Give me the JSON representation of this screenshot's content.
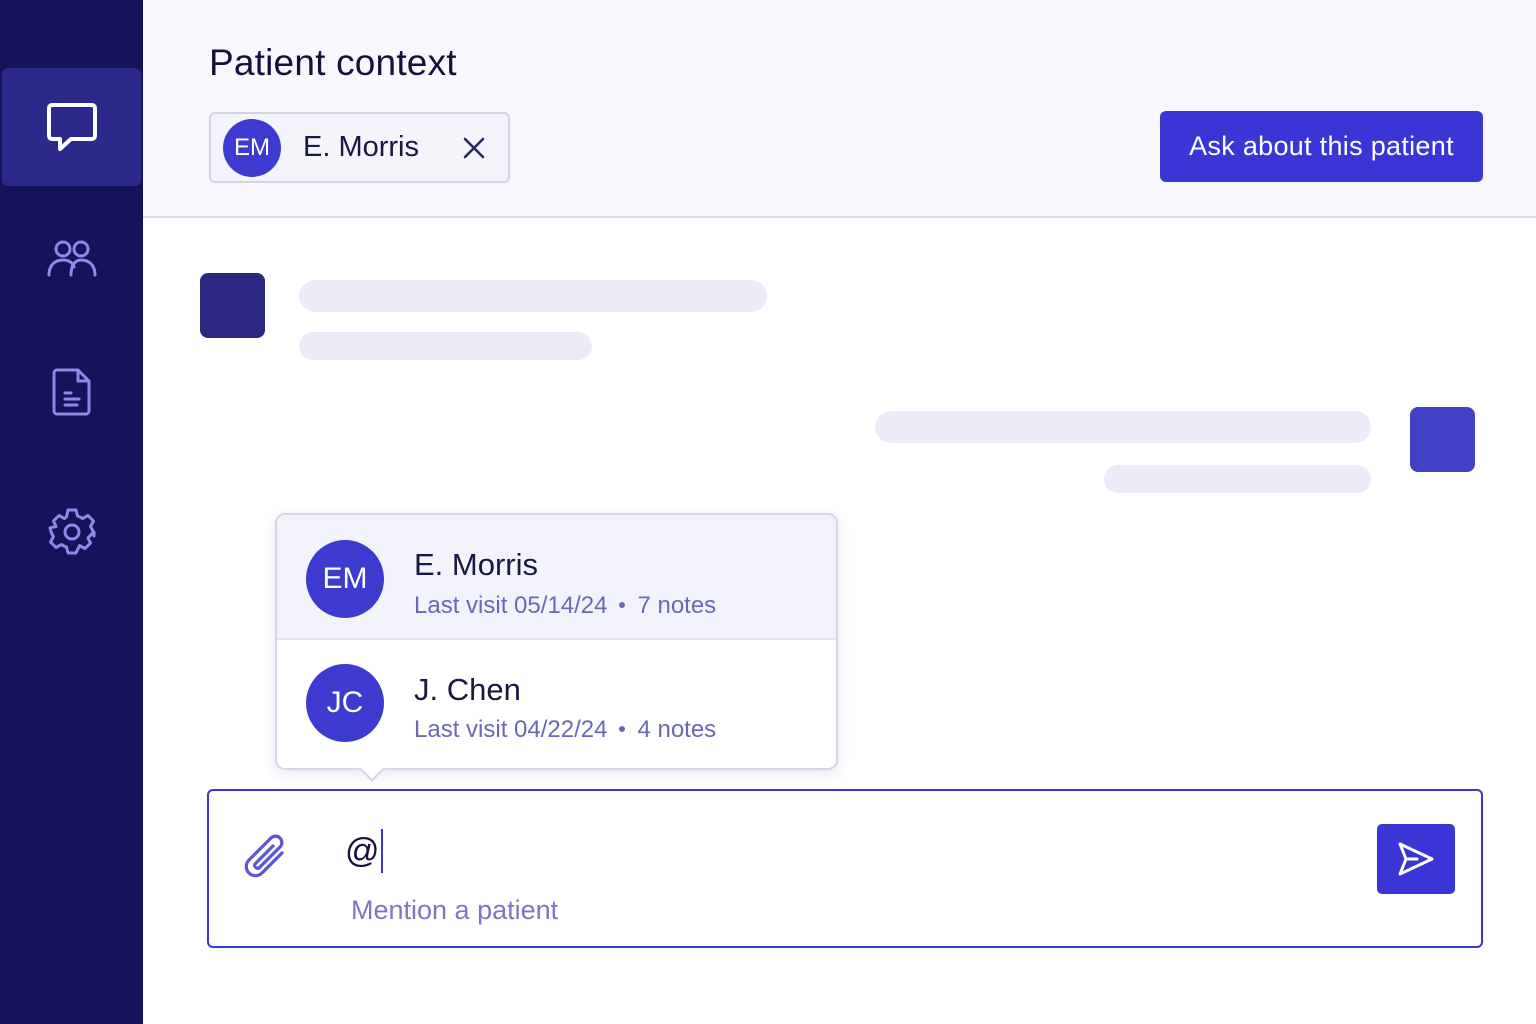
{
  "sidebar": {
    "items": [
      {
        "name": "chat",
        "icon": "chat-bubble-icon",
        "active": true
      },
      {
        "name": "patients",
        "icon": "users-icon",
        "active": false
      },
      {
        "name": "documents",
        "icon": "document-icon",
        "active": false
      },
      {
        "name": "settings",
        "icon": "gear-icon",
        "active": false
      }
    ]
  },
  "header": {
    "title": "Patient context",
    "context_chip": {
      "initials": "EM",
      "name": "E. Morris"
    },
    "ask_button_label": "Ask about this patient"
  },
  "mention_popover": {
    "items": [
      {
        "initials": "EM",
        "name": "E. Morris",
        "last_visit": "Last visit 05/14/24",
        "notes": "7 notes",
        "highlighted": true
      },
      {
        "initials": "JC",
        "name": "J. Chen",
        "last_visit": "Last visit 04/22/24",
        "notes": "4 notes",
        "highlighted": false
      }
    ]
  },
  "composer": {
    "value": "@",
    "hint": "Mention a patient"
  },
  "colors": {
    "sidebar_bg": "#15135a",
    "sidebar_active": "#2b2a8a",
    "accent": "#3a36d6",
    "bot_avatar": "#2a2880",
    "user_avatar": "#4340c8",
    "skeleton": "#ececf8"
  }
}
